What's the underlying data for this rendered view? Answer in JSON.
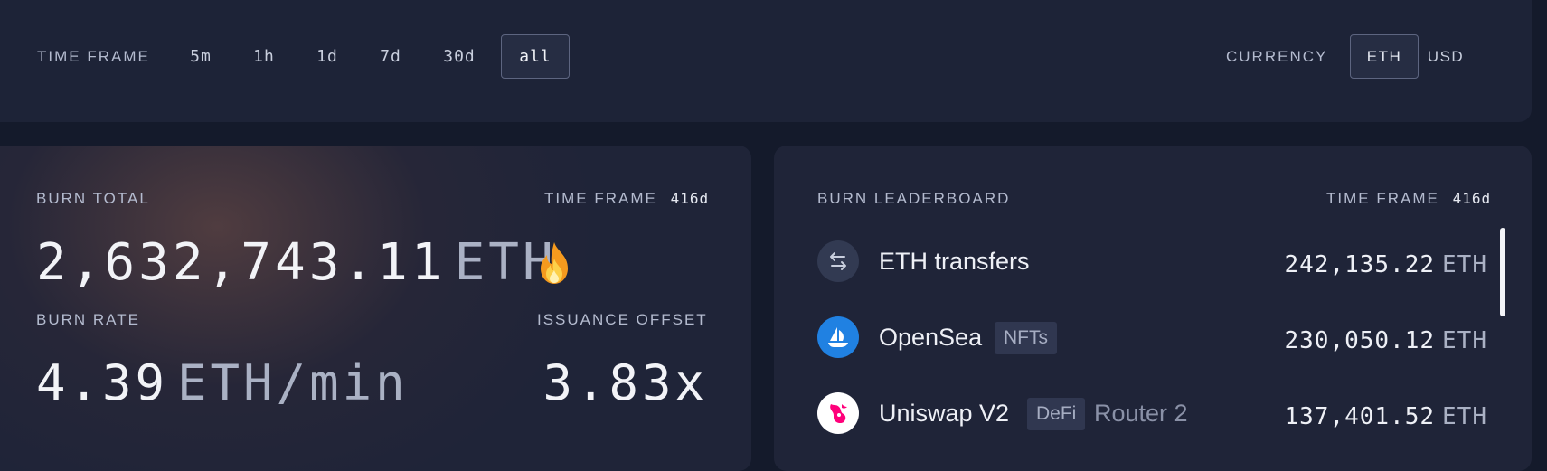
{
  "time_frame": {
    "label": "TIME FRAME",
    "options": [
      "5m",
      "1h",
      "1d",
      "7d",
      "30d",
      "all"
    ],
    "selected": "all"
  },
  "currency": {
    "label": "CURRENCY",
    "options": [
      "ETH",
      "USD"
    ],
    "selected": "ETH"
  },
  "burn_total": {
    "label": "BURN TOTAL",
    "time_frame_label": "TIME FRAME",
    "time_frame_value": "416d",
    "value": "2,632,743.11",
    "unit": "ETH",
    "icon": "flame-icon"
  },
  "burn_rate": {
    "label": "BURN RATE",
    "value": "4.39",
    "unit": "ETH/min"
  },
  "issuance_offset": {
    "label": "ISSUANCE OFFSET",
    "value": "3.83x"
  },
  "leaderboard": {
    "title": "BURN LEADERBOARD",
    "time_frame_label": "TIME FRAME",
    "time_frame_value": "416d",
    "rows": [
      {
        "name": "ETH transfers",
        "tag": "",
        "detail": "",
        "amount": "242,135.22",
        "unit": "ETH",
        "icon": "transfer-arrows-icon"
      },
      {
        "name": "OpenSea",
        "tag": "NFTs",
        "detail": "",
        "amount": "230,050.12",
        "unit": "ETH",
        "icon": "opensea-icon"
      },
      {
        "name": "Uniswap V2",
        "tag": "DeFi",
        "detail": "Router 2",
        "amount": "137,401.52",
        "unit": "ETH",
        "icon": "uniswap-icon"
      }
    ]
  },
  "colors": {
    "background": "#141a2b",
    "card": "#1f2438",
    "opensea_blue": "#2081e2",
    "uniswap_pink": "#ff007a"
  }
}
